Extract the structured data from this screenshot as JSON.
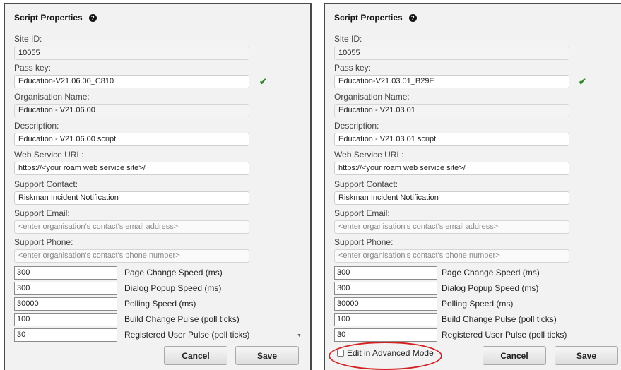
{
  "left": {
    "title": "Script Properties",
    "fields": {
      "site_id_label": "Site ID:",
      "site_id": "10055",
      "pass_key_label": "Pass key:",
      "pass_key": "Education-V21.06.00_C810",
      "org_name_label": "Organisation Name:",
      "org_name": "Education - V21.06.00",
      "description_label": "Description:",
      "description": "Education - V21.06.00 script",
      "web_service_label": "Web Service URL:",
      "web_service": "https://<your roam web service site>/",
      "support_contact_label": "Support Contact:",
      "support_contact": "Riskman Incident Notification",
      "support_email_label": "Support Email:",
      "support_email_placeholder": "<enter organisation's contact's email address>",
      "support_phone_label": "Support Phone:",
      "support_phone_placeholder": "<enter organisation's contact's phone number>"
    },
    "numbers": [
      {
        "value": "300",
        "label": "Page Change Speed (ms)"
      },
      {
        "value": "300",
        "label": "Dialog Popup Speed (ms)"
      },
      {
        "value": "30000",
        "label": "Polling Speed (ms)"
      },
      {
        "value": "100",
        "label": "Build Change Pulse (poll ticks)"
      },
      {
        "value": "30",
        "label": "Registered User Pulse (poll ticks)"
      }
    ],
    "cancel_label": "Cancel",
    "save_label": "Save"
  },
  "right": {
    "title": "Script Properties",
    "fields": {
      "site_id_label": "Site ID:",
      "site_id": "10055",
      "pass_key_label": "Pass key:",
      "pass_key": "Education-V21.03.01_B29E",
      "org_name_label": "Organisation Name:",
      "org_name": "Education - V21.03.01",
      "description_label": "Description:",
      "description": "Education - V21.03.01 script",
      "web_service_label": "Web Service URL:",
      "web_service": "https://<your roam web service site>/",
      "support_contact_label": "Support Contact:",
      "support_contact": "Riskman Incident Notification",
      "support_email_label": "Support Email:",
      "support_email_placeholder": "<enter organisation's contact's email address>",
      "support_phone_label": "Support Phone:",
      "support_phone_placeholder": "<enter organisation's contact's phone number>"
    },
    "numbers": [
      {
        "value": "300",
        "label": "Page Change Speed (ms)"
      },
      {
        "value": "300",
        "label": "Dialog Popup Speed (ms)"
      },
      {
        "value": "30000",
        "label": "Polling Speed (ms)"
      },
      {
        "value": "100",
        "label": "Build Change Pulse (poll ticks)"
      },
      {
        "value": "30",
        "label": "Registered User Pulse (poll ticks)"
      }
    ],
    "advanced_mode_label": "Edit in Advanced Mode",
    "cancel_label": "Cancel",
    "save_label": "Save"
  },
  "icons": {
    "help": "?",
    "check": "✔",
    "scroll_down": "▼"
  },
  "colors": {
    "check": "#2e8b2e",
    "highlight": "#d42020",
    "panel_border": "#4a4a4a"
  }
}
